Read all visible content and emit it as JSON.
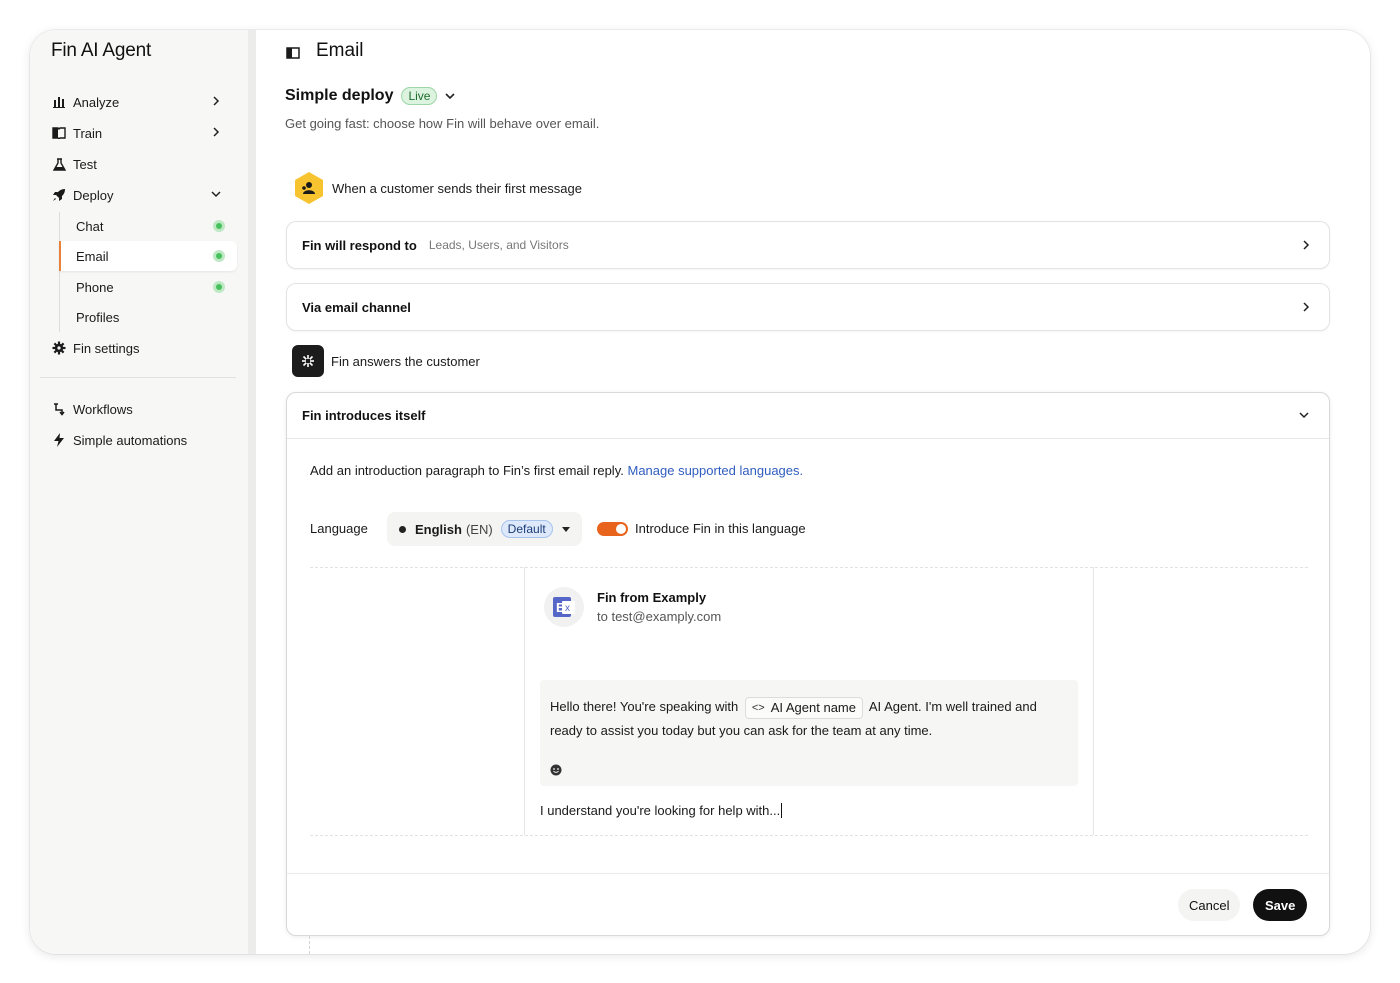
{
  "app": {
    "title": "Fin AI Agent"
  },
  "sidebar": {
    "items": [
      {
        "label": "Analyze",
        "icon": "bar-chart-icon"
      },
      {
        "label": "Train",
        "icon": "book-icon"
      },
      {
        "label": "Test",
        "icon": "flask-icon"
      },
      {
        "label": "Deploy",
        "icon": "rocket-icon"
      }
    ],
    "deploy_children": [
      {
        "label": "Chat",
        "status": "live"
      },
      {
        "label": "Email",
        "status": "live",
        "active": true
      },
      {
        "label": "Phone",
        "status": "live"
      },
      {
        "label": "Profiles"
      }
    ],
    "fin_settings": "Fin settings",
    "workflows": "Workflows",
    "simple_automations": "Simple automations"
  },
  "page": {
    "title": "Email",
    "deploy_title": "Simple deploy",
    "live_badge": "Live",
    "description": "Get going fast: choose how Fin will behave over email."
  },
  "steps": {
    "trigger": "When a customer sends their first message",
    "respond_label": "Fin will respond to",
    "respond_value": "Leads, Users, and Visitors",
    "channel": "Via email channel",
    "answers": "Fin answers the customer"
  },
  "intro_section": {
    "title": "Fin introduces itself",
    "description": "Add an introduction paragraph to Fin’s first email reply.",
    "link": "Manage supported languages.",
    "language_label": "Language",
    "language_name": "English",
    "language_code": "(EN)",
    "default_badge": "Default",
    "toggle_label": "Introduce Fin in this language",
    "toggle_on": true
  },
  "email_preview": {
    "sender": "Fin from Examply",
    "recipient": "to test@examply.com",
    "message_before": "Hello there! You're speaking with",
    "attribute_chip": "AI Agent name",
    "message_after": "AI Agent. I'm well trained and ready to assist you today but you can ask for the team at any time.",
    "reply": "I understand you're looking for help with..."
  },
  "actions": {
    "cancel": "Cancel",
    "save": "Save"
  },
  "colors": {
    "accent": "#e8641d",
    "live": "#47c15d",
    "link": "#2f5dbf"
  }
}
